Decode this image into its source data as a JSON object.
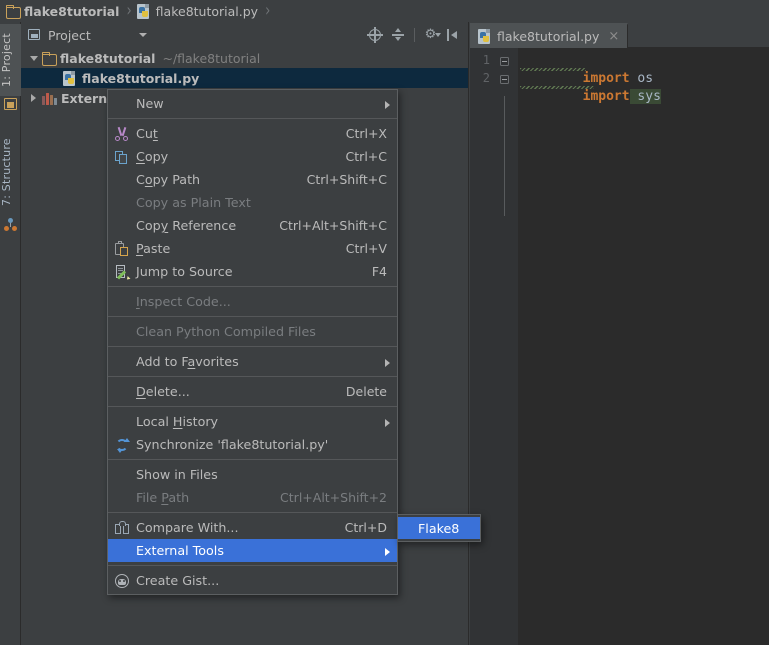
{
  "breadcrumb": {
    "items": [
      {
        "label": "flake8tutorial",
        "icon": "folder-icon"
      },
      {
        "label": "flake8tutorial.py",
        "icon": "python-file-icon"
      }
    ],
    "separator": "›"
  },
  "left_rail": {
    "tabs": [
      {
        "label": "1: Project",
        "icon": "project-icon",
        "active": true
      },
      {
        "label": "7: Structure",
        "icon": "structure-icon",
        "active": false
      }
    ]
  },
  "project_panel": {
    "combo_label": "Project",
    "combo_icon": "project-view-icon",
    "toolbar": [
      {
        "name": "locate-icon",
        "title": "Select Opened File"
      },
      {
        "name": "collapse-all-icon",
        "title": "Collapse All"
      },
      {
        "name": "gear-icon",
        "title": "Settings"
      },
      {
        "name": "hide-panel-icon",
        "title": "Hide"
      }
    ],
    "tree": [
      {
        "label": "flake8tutorial",
        "secondary": "~/flake8tutorial",
        "icon": "folder-icon",
        "twisty": "open",
        "indent": 0,
        "selected": false
      },
      {
        "label": "flake8tutorial.py",
        "secondary": "",
        "icon": "python-file-icon",
        "twisty": "none",
        "indent": 1,
        "selected": true
      },
      {
        "label": "External Libraries",
        "secondary": "",
        "icon": "library-icon",
        "twisty": "closed",
        "indent": 0,
        "selected": false
      }
    ]
  },
  "editor": {
    "tab": {
      "label": "flake8tutorial.py",
      "icon": "python-file-icon",
      "close": "×"
    },
    "lines": [
      {
        "number": "1",
        "keyword": "import",
        "identifier": " os",
        "highlighted": false
      },
      {
        "number": "2",
        "keyword": "import",
        "identifier": " sys",
        "highlighted": true
      }
    ]
  },
  "context_menu": {
    "items": [
      {
        "label": "New",
        "accel": "",
        "icon": "",
        "submenu": true,
        "disabled": false,
        "highlight": false,
        "mnemonic": ""
      },
      {
        "separator": true
      },
      {
        "label": "Cut",
        "accel": "Ctrl+X",
        "icon": "cut-icon",
        "submenu": false,
        "disabled": false,
        "highlight": false,
        "mnemonic": "t"
      },
      {
        "label": "Copy",
        "accel": "Ctrl+C",
        "icon": "copy-icon",
        "submenu": false,
        "disabled": false,
        "highlight": false,
        "mnemonic": "C"
      },
      {
        "label": "Copy Path",
        "accel": "Ctrl+Shift+C",
        "icon": "",
        "submenu": false,
        "disabled": false,
        "highlight": false,
        "mnemonic": "o"
      },
      {
        "label": "Copy as Plain Text",
        "accel": "",
        "icon": "",
        "submenu": false,
        "disabled": true,
        "highlight": false,
        "mnemonic": ""
      },
      {
        "label": "Copy Reference",
        "accel": "Ctrl+Alt+Shift+C",
        "icon": "",
        "submenu": false,
        "disabled": false,
        "highlight": false,
        "mnemonic": "y"
      },
      {
        "label": "Paste",
        "accel": "Ctrl+V",
        "icon": "paste-icon",
        "submenu": false,
        "disabled": false,
        "highlight": false,
        "mnemonic": "P"
      },
      {
        "label": "Jump to Source",
        "accel": "F4",
        "icon": "jump-to-source-icon",
        "submenu": false,
        "disabled": false,
        "highlight": false,
        "mnemonic": ""
      },
      {
        "separator": true
      },
      {
        "label": "Inspect Code...",
        "accel": "",
        "icon": "",
        "submenu": false,
        "disabled": true,
        "highlight": false,
        "mnemonic": "I"
      },
      {
        "separator": true
      },
      {
        "label": "Clean Python Compiled Files",
        "accel": "",
        "icon": "",
        "submenu": false,
        "disabled": true,
        "highlight": false,
        "mnemonic": ""
      },
      {
        "separator": true
      },
      {
        "label": "Add to Favorites",
        "accel": "",
        "icon": "",
        "submenu": true,
        "disabled": false,
        "highlight": false,
        "mnemonic": "a"
      },
      {
        "separator": true
      },
      {
        "label": "Delete...",
        "accel": "Delete",
        "icon": "",
        "submenu": false,
        "disabled": false,
        "highlight": false,
        "mnemonic": "D"
      },
      {
        "separator": true
      },
      {
        "label": "Local History",
        "accel": "",
        "icon": "",
        "submenu": true,
        "disabled": false,
        "highlight": false,
        "mnemonic": "H"
      },
      {
        "label": "Synchronize 'flake8tutorial.py'",
        "accel": "",
        "icon": "synchronize-icon",
        "submenu": false,
        "disabled": false,
        "highlight": false,
        "mnemonic": ""
      },
      {
        "separator": true
      },
      {
        "label": "Show in Files",
        "accel": "",
        "icon": "",
        "submenu": false,
        "disabled": false,
        "highlight": false,
        "mnemonic": ""
      },
      {
        "label": "File Path",
        "accel": "Ctrl+Alt+Shift+2",
        "icon": "",
        "submenu": false,
        "disabled": true,
        "highlight": false,
        "mnemonic": "P"
      },
      {
        "separator": true
      },
      {
        "label": "Compare With...",
        "accel": "Ctrl+D",
        "icon": "compare-icon",
        "submenu": false,
        "disabled": false,
        "highlight": false,
        "mnemonic": ""
      },
      {
        "label": "External Tools",
        "accel": "",
        "icon": "",
        "submenu": true,
        "disabled": false,
        "highlight": true,
        "mnemonic": ""
      },
      {
        "separator": true
      },
      {
        "label": "Create Gist...",
        "accel": "",
        "icon": "create-gist-icon",
        "submenu": false,
        "disabled": false,
        "highlight": false,
        "mnemonic": ""
      }
    ]
  },
  "submenu": {
    "items": [
      {
        "label": "Flake8",
        "highlight": true
      }
    ]
  },
  "colors": {
    "window_bg": "#3c3f41",
    "editor_bg": "#2b2b2b",
    "gutter_bg": "#313335",
    "menu_bg": "#3c3f41",
    "menu_border": "#5c5f61",
    "highlight_blue": "#3a71d8",
    "tree_selection": "#0d293e",
    "text": "#bbbbbb",
    "text_disabled": "#7a7d80",
    "keyword_orange": "#cc7832",
    "identifier": "#a9b7c6",
    "folder_gold": "#c9a15a",
    "sync_blue": "#5394d6"
  }
}
